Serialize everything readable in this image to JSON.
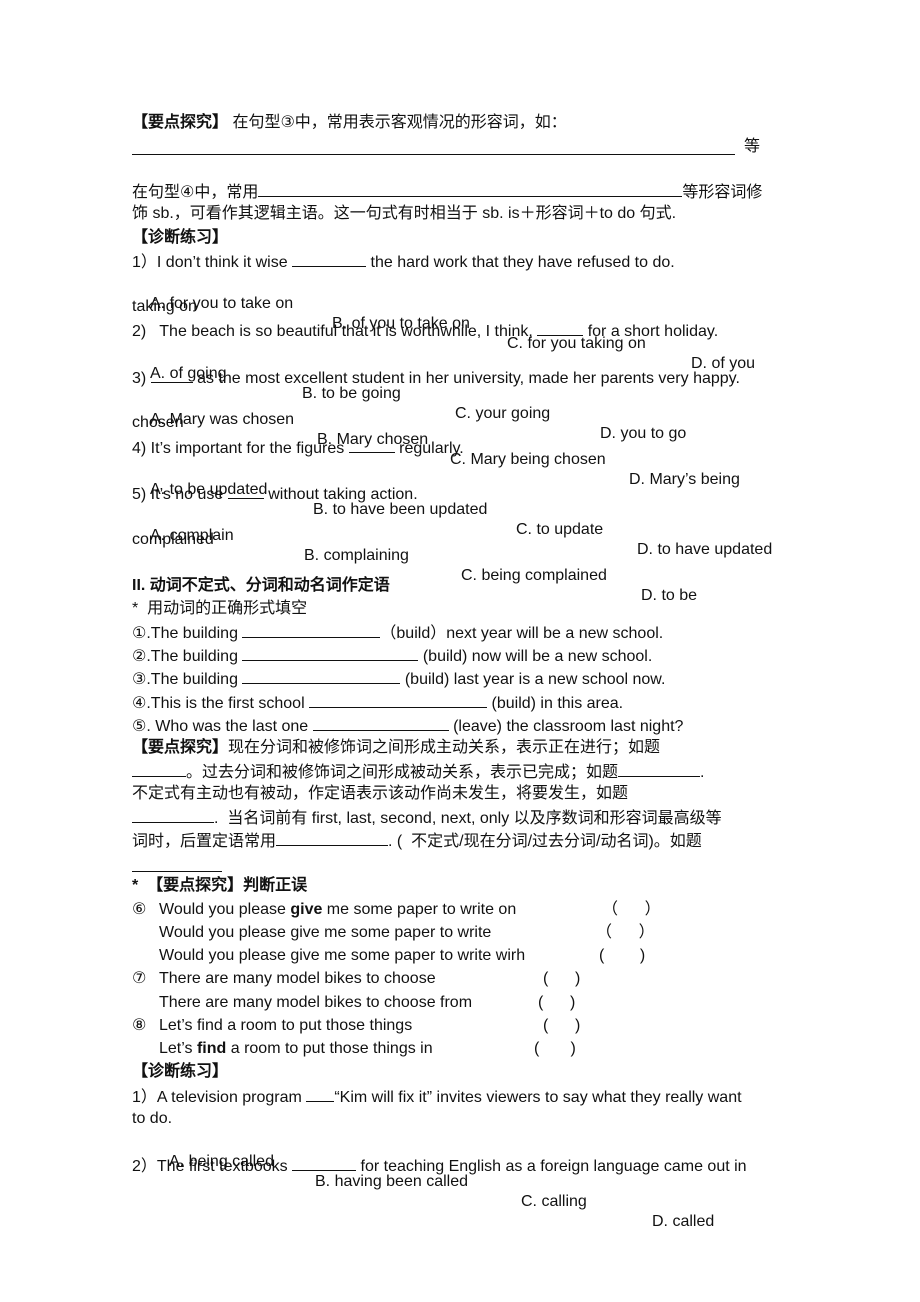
{
  "section_a": {
    "key_heading": "【要点探究】",
    "key_text1": " 在句型③中，常用表示客观情况的形容词，如：",
    "key_end1": "等",
    "key_text2a": "在句型④中，常用",
    "key_text2b": "等形容词修",
    "key_text3": "饰 sb.，可看作其逻辑主语。这一句式有时相当于 sb. is＋形容词＋to do 句式.",
    "practice_heading": "【诊断练习】",
    "questions": [
      {
        "stem_a": "1）I don’t think it wise ",
        "stem_b": " the hard work that they have refused to do.",
        "options": [
          "A. for you to take on",
          "B. of you to take on",
          "C. for you taking on",
          "D. of you"
        ],
        "wrap": "taking on"
      },
      {
        "stem_a": "2)   The beach is so beautiful that it is worthwhile, I think, ",
        "stem_b": " for a short holiday.",
        "options": [
          "A. of going",
          "B. to be going",
          "C. your going",
          "D. you to go"
        ],
        "wrap": ""
      },
      {
        "stem_a": "3) ",
        "stem_b": " as the most excellent student in her university, made her parents very happy.",
        "options": [
          "A. Mary was chosen",
          "B. Mary chosen",
          "C. Mary being chosen",
          "D. Mary’s being"
        ],
        "wrap": "chosen"
      },
      {
        "stem_a": "4) It’s important for the figures ",
        "stem_b": " regularly.",
        "options": [
          "A. to be updated",
          "B. to have been updated",
          "C. to update",
          "D. to have updated"
        ],
        "wrap": ""
      },
      {
        "stem_a": "5) It’s no use ",
        "stem_b": " without taking action.",
        "options": [
          "A. complain",
          "B. complaining",
          "C. being complained",
          "D. to be"
        ],
        "wrap": "complained"
      }
    ]
  },
  "section_b": {
    "title_num": "II.",
    "title_text": " 动词不定式、分词和动名词作定语",
    "instruction": "*  用动词的正确形式填空",
    "fill": [
      {
        "a": "①.The building ",
        "b": "（build）next year will be a new school."
      },
      {
        "a": "②.The building ",
        "b": " (build) now will be a new school."
      },
      {
        "a": "③.The building ",
        "b": " (build) last year is a new school now."
      },
      {
        "a": "④.This is the first school ",
        "b": " (build) in this area."
      },
      {
        "a": "⑤. Who was the last one ",
        "b": " (leave) the classroom last night?"
      }
    ],
    "key_heading": "【要点探究】",
    "key_p1": "现在分词和被修饰词之间形成主动关系，表示正在进行；如题",
    "key_p2a": "。过去分词和被修饰词之间形成被动关系，表示已完成；如题",
    "key_p2b": ".",
    "key_p3": "不定式有主动也有被动，作定语表示该动作尚未发生，将要发生，如题",
    "key_p4": ".  当名词前有 first, last, second, next, only 以及序数词和形容词最高级等",
    "key_p5a": "词时，后置定语常用",
    "key_p5b": ". (  不定式/现在分词/过去分词/动名词)。如题",
    "judge_heading": "*  【要点探究】判断正误",
    "judge": [
      {
        "num": "⑥",
        "pre": "Would you please ",
        "bold": "give",
        "post": " me some paper to write on",
        "paren": "（      ）"
      },
      {
        "num": "",
        "pre": "Would you please give me some paper to write",
        "bold": "",
        "post": "",
        "paren": "（      ）"
      },
      {
        "num": "",
        "pre": "Would you please give me some paper to write wirh",
        "bold": "",
        "post": "",
        "paren": "(        )"
      },
      {
        "num": "⑦",
        "pre": "There are many model bikes to choose",
        "bold": "",
        "post": "",
        "paren": "(      )"
      },
      {
        "num": "",
        "pre": "There are many model bikes to choose from",
        "bold": "",
        "post": "",
        "paren": "(      )"
      },
      {
        "num": "⑧",
        "pre": "Let’s find a room to put those things",
        "bold": "",
        "post": "",
        "paren": "(      )"
      },
      {
        "num": "",
        "pre": "Let’s ",
        "bold": "find",
        "post": " a room to put those things in",
        "paren": "(       )"
      }
    ],
    "practice_heading": "【诊断练习】",
    "q1_a": "1）A television program ",
    "q1_b": "“Kim will fix it” invites viewers to say what they really want",
    "q1_wrap": "to do.",
    "q1_options": [
      "A. being called",
      "B. having been called",
      "C. calling",
      "D. called"
    ],
    "q2_a": "2）The first textbooks ",
    "q2_b": " for teaching English as a foreign language came out in"
  }
}
